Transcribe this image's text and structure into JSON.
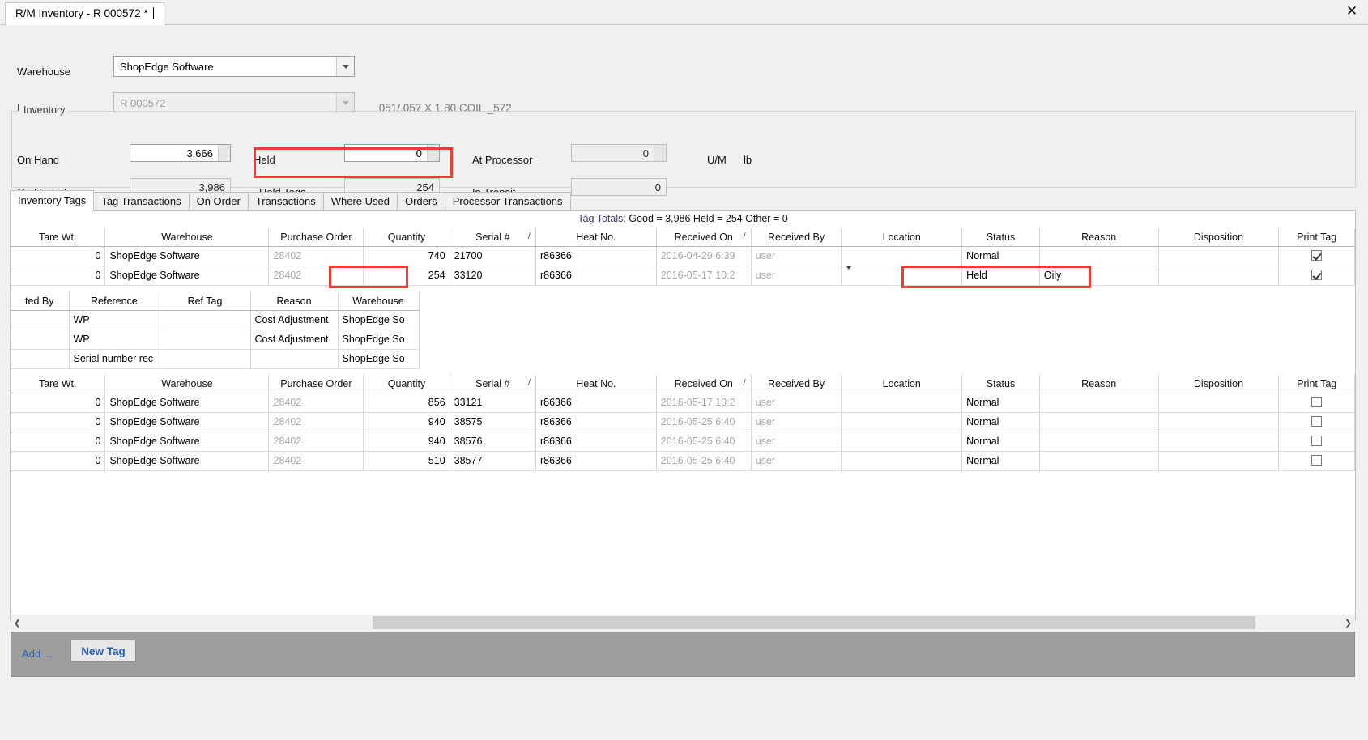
{
  "window": {
    "tab_title": "R/M Inventory - R 000572 *",
    "close_icon": "close-icon"
  },
  "form": {
    "warehouse_label": "Warehouse",
    "warehouse_value": "ShopEdge Software",
    "item_label": "Item",
    "item_value": "R 000572",
    "item_description": ".051/.057 X 1.80  COIL  _572"
  },
  "inventory": {
    "group_title": "Inventory",
    "on_hand_label": "On Hand",
    "on_hand_value": "3,666",
    "held_label": "Held",
    "held_value": "0",
    "at_processor_label": "At Processor",
    "at_processor_value": "0",
    "um_label": "U/M",
    "um_value": "lb",
    "on_hand_tags_label": "On Hand Tags",
    "on_hand_tags_value": "3,986",
    "held_tags_label": "Held Tags",
    "held_tags_value": "254",
    "in_transit_label": "In Transit",
    "in_transit_value": "0"
  },
  "tabs": [
    {
      "label": "Inventory Tags",
      "active": true
    },
    {
      "label": "Tag Transactions",
      "active": false
    },
    {
      "label": "On Order",
      "active": false
    },
    {
      "label": "Transactions",
      "active": false
    },
    {
      "label": "Where Used",
      "active": false
    },
    {
      "label": "Orders",
      "active": false
    },
    {
      "label": "Processor Transactions",
      "active": false
    }
  ],
  "tag_totals": {
    "prefix": "Tag Totals:",
    "text": "Good = 3,986 Held = 254 Other = 0"
  },
  "grid": {
    "columns": [
      "Tare Wt.",
      "Warehouse",
      "Purchase Order",
      "Quantity",
      "Serial #",
      "Heat No.",
      "Received On",
      "Received By",
      "Location",
      "Status",
      "Reason",
      "Disposition",
      "Print Tag"
    ],
    "sort_marks": {
      "serial": "/",
      "received_on": "/"
    },
    "top_rows": [
      {
        "tare_wt": "0",
        "warehouse": "ShopEdge Software",
        "purchase_order": "28402",
        "quantity": "740",
        "serial": "21700",
        "heat_no": "r86366",
        "received_on": "2016-04-29 6:39",
        "received_by": "user",
        "location": "",
        "status": "Normal",
        "reason": "",
        "disposition": "",
        "print_tag": true
      },
      {
        "tare_wt": "0",
        "warehouse": "ShopEdge Software",
        "purchase_order": "28402",
        "quantity": "254",
        "serial": "33120",
        "heat_no": "r86366",
        "received_on": "2016-05-17 10:2",
        "received_by": "user",
        "location": "",
        "status": "Held",
        "reason": "Oily",
        "disposition": "",
        "print_tag": true
      }
    ],
    "bottom_rows": [
      {
        "tare_wt": "0",
        "warehouse": "ShopEdge Software",
        "purchase_order": "28402",
        "quantity": "856",
        "serial": "33121",
        "heat_no": "r86366",
        "received_on": "2016-05-17 10:2",
        "received_by": "user",
        "location": "",
        "status": "Normal",
        "reason": "",
        "disposition": "",
        "print_tag": false
      },
      {
        "tare_wt": "0",
        "warehouse": "ShopEdge Software",
        "purchase_order": "28402",
        "quantity": "940",
        "serial": "38575",
        "heat_no": "r86366",
        "received_on": "2016-05-25 6:40",
        "received_by": "user",
        "location": "",
        "status": "Normal",
        "reason": "",
        "disposition": "",
        "print_tag": false
      },
      {
        "tare_wt": "0",
        "warehouse": "ShopEdge Software",
        "purchase_order": "28402",
        "quantity": "940",
        "serial": "38576",
        "heat_no": "r86366",
        "received_on": "2016-05-25 6:40",
        "received_by": "user",
        "location": "",
        "status": "Normal",
        "reason": "",
        "disposition": "",
        "print_tag": false
      },
      {
        "tare_wt": "0",
        "warehouse": "ShopEdge Software",
        "purchase_order": "28402",
        "quantity": "510",
        "serial": "38577",
        "heat_no": "r86366",
        "received_on": "2016-05-25 6:40",
        "received_by": "user",
        "location": "",
        "status": "Normal",
        "reason": "",
        "disposition": "",
        "print_tag": false
      }
    ]
  },
  "detail_grid": {
    "columns": [
      "ted By",
      "Reference",
      "Ref Tag",
      "Reason",
      "Warehouse"
    ],
    "rows": [
      {
        "ted_by": "",
        "reference": "WP",
        "ref_tag": "",
        "reason": "Cost Adjustment",
        "warehouse": "ShopEdge So"
      },
      {
        "ted_by": "",
        "reference": "WP",
        "ref_tag": "",
        "reason": "Cost Adjustment",
        "warehouse": "ShopEdge So"
      },
      {
        "ted_by": "",
        "reference": "Serial number rec",
        "ref_tag": "",
        "reason": "",
        "warehouse": "ShopEdge So"
      }
    ]
  },
  "scrollbar": {
    "left_arrow": "chevron-left-icon",
    "right_arrow": "chevron-right-icon"
  },
  "bottom_bar": {
    "add_label": "Add ...",
    "new_tag_label": "New Tag"
  },
  "colors": {
    "highlight": "#ef3b34",
    "link": "#2b5fb4",
    "bottom_bar_bg": "#9e9e9e"
  }
}
